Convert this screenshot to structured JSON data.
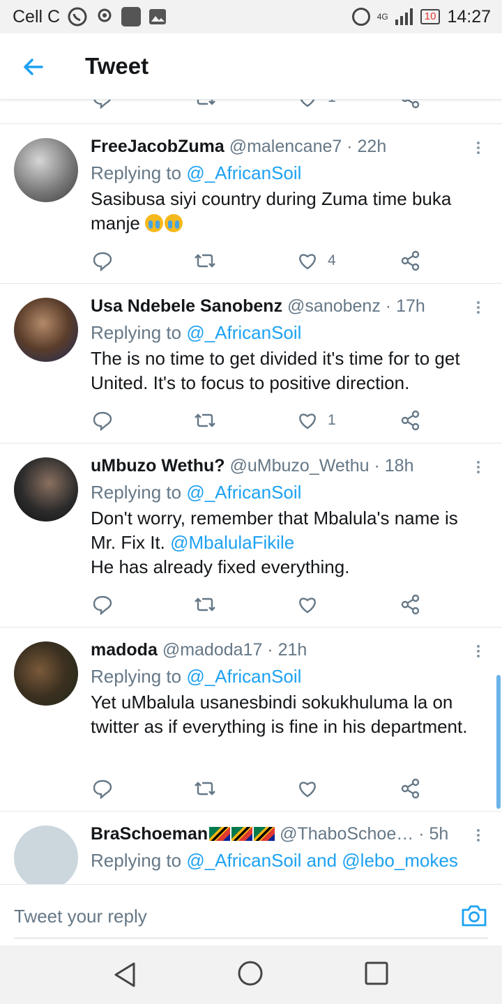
{
  "status_bar": {
    "carrier": "Cell C",
    "network": "4G",
    "battery": "10",
    "time": "14:27"
  },
  "header": {
    "title": "Tweet"
  },
  "tweets": [
    {
      "name": "FreeJacobZuma",
      "handle": "@malencane7",
      "time": "· 22h",
      "replying_prefix": "Replying to",
      "replying_to": "@_AfricanSoil",
      "text": "Sasibusa siyi country during Zuma time buka manje",
      "emoji": "crying-face x2",
      "like_count": "4"
    },
    {
      "name": "Usa Ndebele Sanobenz",
      "handle": "@sanobenz",
      "time": "· 17h",
      "replying_prefix": "Replying to",
      "replying_to": "@_AfricanSoil",
      "text": "The is no time to get divided it's time for to get United. It's to focus to positive direction.",
      "like_count": "1"
    },
    {
      "name": "uMbuzo Wethu?",
      "handle": "@uMbuzo_Wethu",
      "time": "· 18h",
      "replying_prefix": "Replying to",
      "replying_to": "@_AfricanSoil",
      "text_1": "Don't worry, remember that Mbalula's name is Mr. Fix It.",
      "text_mention": "@MbalulaFikile",
      "text_2": "He has already fixed everything.",
      "like_count": ""
    },
    {
      "name": "madoda",
      "handle": "@madoda17",
      "time": "· 21h",
      "replying_prefix": "Replying to",
      "replying_to": "@_AfricanSoil",
      "text": "Yet uMbalula usanesbindi sokukhuluma la on twitter as if everything is fine in his department.",
      "like_count": ""
    },
    {
      "name": "BraSchoeman",
      "handle": "@ThaboSchoe…",
      "time": "· 5h",
      "replying_prefix": "Replying to",
      "replying_to": "@_AfricanSoil and @lebo_mokes"
    }
  ],
  "partial_tweet_above": {
    "like_count": "1"
  },
  "composer": {
    "placeholder": "Tweet your reply"
  },
  "colors": {
    "accent": "#1da1f2",
    "secondary_text": "#657786",
    "divider": "#e1e8ed"
  }
}
